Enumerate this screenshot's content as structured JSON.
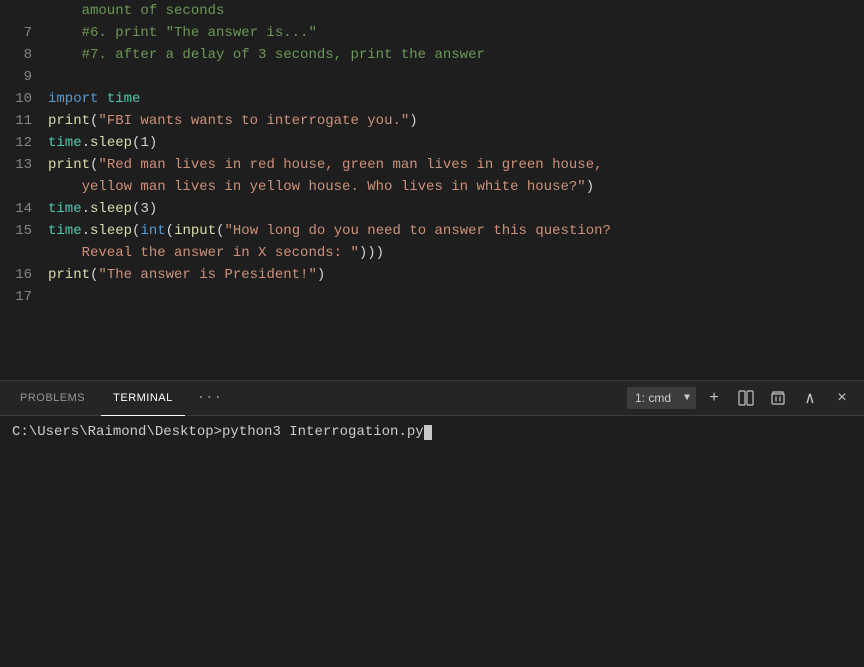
{
  "editor": {
    "lines": [
      {
        "number": "",
        "type": "comment-continuation",
        "raw": "    amount of seconds"
      },
      {
        "number": "7",
        "type": "comment",
        "raw": "    #6. print \"The answer is...\""
      },
      {
        "number": "8",
        "type": "comment",
        "raw": "    #7. after a delay of 3 seconds, print the answer"
      },
      {
        "number": "9",
        "type": "empty"
      },
      {
        "number": "10",
        "type": "import"
      },
      {
        "number": "11",
        "type": "print1"
      },
      {
        "number": "12",
        "type": "sleep1"
      },
      {
        "number": "13",
        "type": "print2-line1"
      },
      {
        "number": "",
        "type": "print2-line2"
      },
      {
        "number": "14",
        "type": "sleep2"
      },
      {
        "number": "15",
        "type": "sleep3-line1"
      },
      {
        "number": "",
        "type": "sleep3-line2"
      },
      {
        "number": "16",
        "type": "print3"
      },
      {
        "number": "17",
        "type": "empty"
      }
    ]
  },
  "panel": {
    "tabs": [
      {
        "label": "PROBLEMS",
        "active": false
      },
      {
        "label": "TERMINAL",
        "active": true
      }
    ],
    "ellipsis": "···",
    "terminal_options": [
      "1: cmd"
    ],
    "terminal_selected": "1: cmd",
    "actions": {
      "add": "+",
      "split": "⧉",
      "delete": "🗑",
      "maximize": "∧",
      "close": "×"
    },
    "terminal_prompt": "C:\\Users\\Raimond\\Desktop>python3 Interrogation.py"
  }
}
